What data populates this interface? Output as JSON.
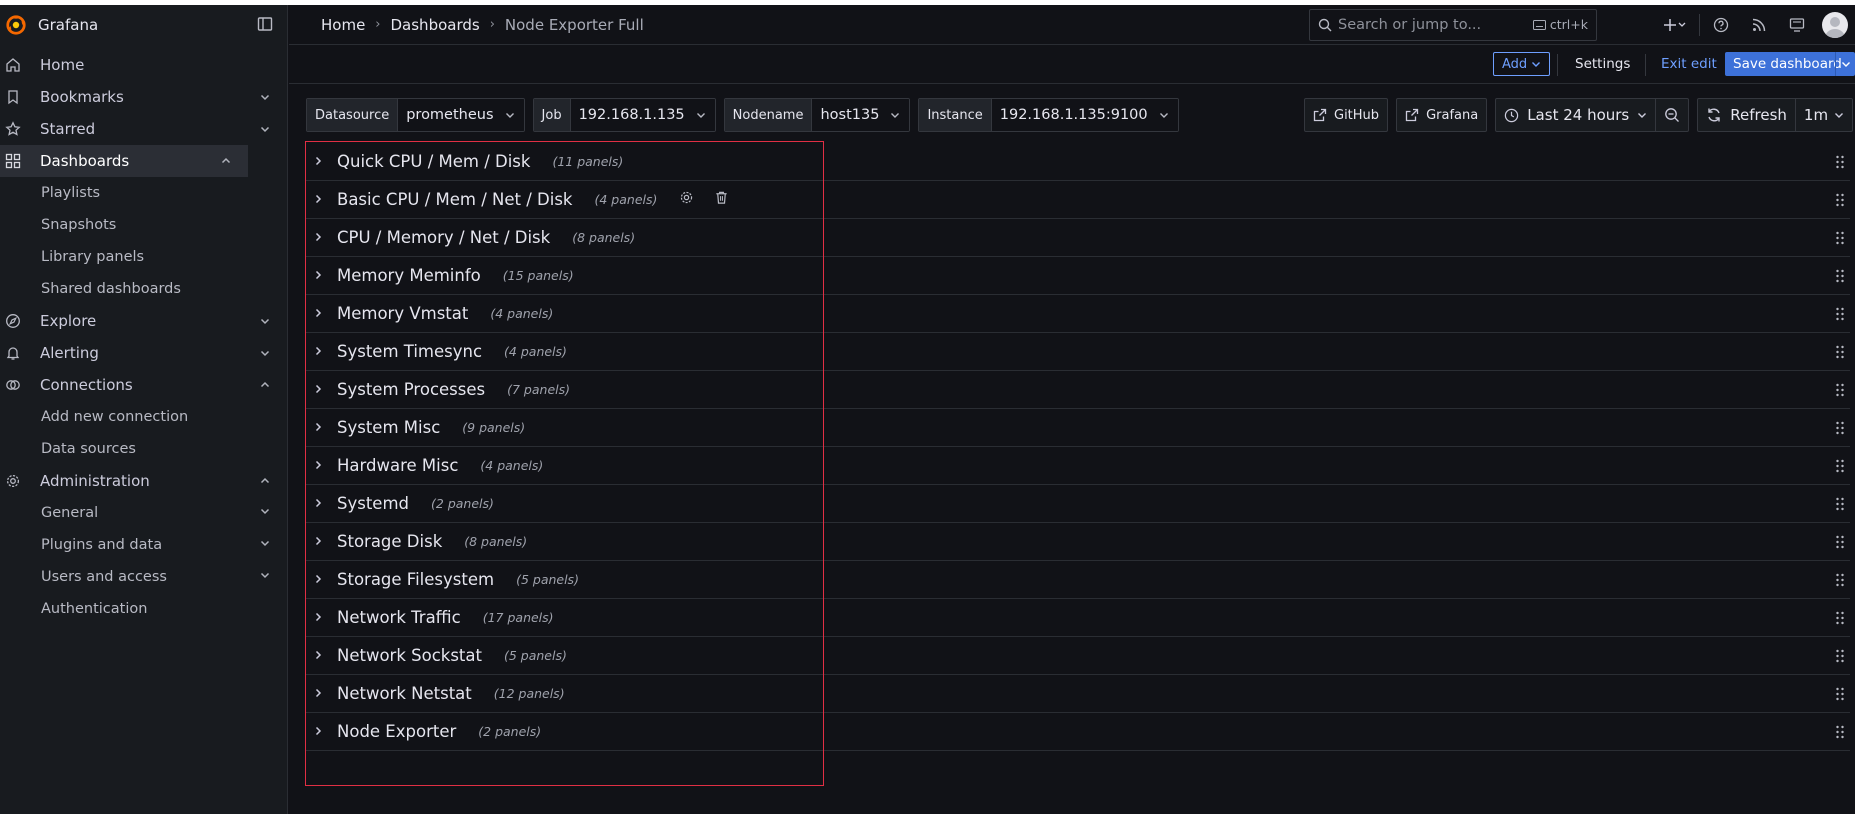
{
  "app": {
    "name": "Grafana"
  },
  "sidebar": {
    "items": [
      {
        "label": "Home",
        "icon": "home-icon",
        "chevron": "none"
      },
      {
        "label": "Bookmarks",
        "icon": "bookmark-icon",
        "chevron": "down"
      },
      {
        "label": "Starred",
        "icon": "star-icon",
        "chevron": "down"
      },
      {
        "label": "Dashboards",
        "icon": "apps-icon",
        "chevron": "up",
        "active": true
      },
      {
        "label": "Playlists",
        "sub": true
      },
      {
        "label": "Snapshots",
        "sub": true
      },
      {
        "label": "Library panels",
        "sub": true
      },
      {
        "label": "Shared dashboards",
        "sub": true
      },
      {
        "label": "Explore",
        "icon": "compass-icon",
        "chevron": "down"
      },
      {
        "label": "Alerting",
        "icon": "bell-icon",
        "chevron": "down"
      },
      {
        "label": "Connections",
        "icon": "link-icon",
        "chevron": "up"
      },
      {
        "label": "Add new connection",
        "sub": true
      },
      {
        "label": "Data sources",
        "sub": true
      },
      {
        "label": "Administration",
        "icon": "cog-icon",
        "chevron": "up"
      },
      {
        "label": "General",
        "sub": true,
        "chevron": "down"
      },
      {
        "label": "Plugins and data",
        "sub": true,
        "chevron": "down"
      },
      {
        "label": "Users and access",
        "sub": true,
        "chevron": "down"
      },
      {
        "label": "Authentication",
        "sub": true
      }
    ]
  },
  "header": {
    "breadcrumbs": [
      "Home",
      "Dashboards",
      "Node Exporter Full"
    ],
    "search_placeholder": "Search or jump to...",
    "search_shortcut": "ctrl+k"
  },
  "toolbar": {
    "add_label": "Add",
    "settings_label": "Settings",
    "exit_edit_label": "Exit edit",
    "save_label": "Save dashboard"
  },
  "variables": [
    {
      "label": "Datasource",
      "value": "prometheus"
    },
    {
      "label": "Job",
      "value": "192.168.1.135"
    },
    {
      "label": "Nodename",
      "value": "host135"
    },
    {
      "label": "Instance",
      "value": "192.168.1.135:9100"
    }
  ],
  "links": [
    {
      "label": "GitHub"
    },
    {
      "label": "Grafana"
    }
  ],
  "time_range": {
    "label": "Last 24 hours"
  },
  "refresh": {
    "label": "Refresh",
    "interval": "1m"
  },
  "rows": [
    {
      "title": "Quick CPU / Mem / Disk",
      "count": "(11 panels)"
    },
    {
      "title": "Basic CPU / Mem / Net / Disk",
      "count": "(4 panels)",
      "actions": true
    },
    {
      "title": "CPU / Memory / Net / Disk",
      "count": "(8 panels)"
    },
    {
      "title": "Memory Meminfo",
      "count": "(15 panels)"
    },
    {
      "title": "Memory Vmstat",
      "count": "(4 panels)"
    },
    {
      "title": "System Timesync",
      "count": "(4 panels)"
    },
    {
      "title": "System Processes",
      "count": "(7 panels)"
    },
    {
      "title": "System Misc",
      "count": "(9 panels)"
    },
    {
      "title": "Hardware Misc",
      "count": "(4 panels)"
    },
    {
      "title": "Systemd",
      "count": "(2 panels)"
    },
    {
      "title": "Storage Disk",
      "count": "(8 panels)"
    },
    {
      "title": "Storage Filesystem",
      "count": "(5 panels)"
    },
    {
      "title": "Network Traffic",
      "count": "(17 panels)"
    },
    {
      "title": "Network Sockstat",
      "count": "(5 panels)"
    },
    {
      "title": "Network Netstat",
      "count": "(12 panels)"
    },
    {
      "title": "Node Exporter",
      "count": "(2 panels)"
    }
  ],
  "colors": {
    "accent": "#3d71d9",
    "link": "#6e9fff",
    "highlight": "#e02f44",
    "logo": "#f46800"
  }
}
